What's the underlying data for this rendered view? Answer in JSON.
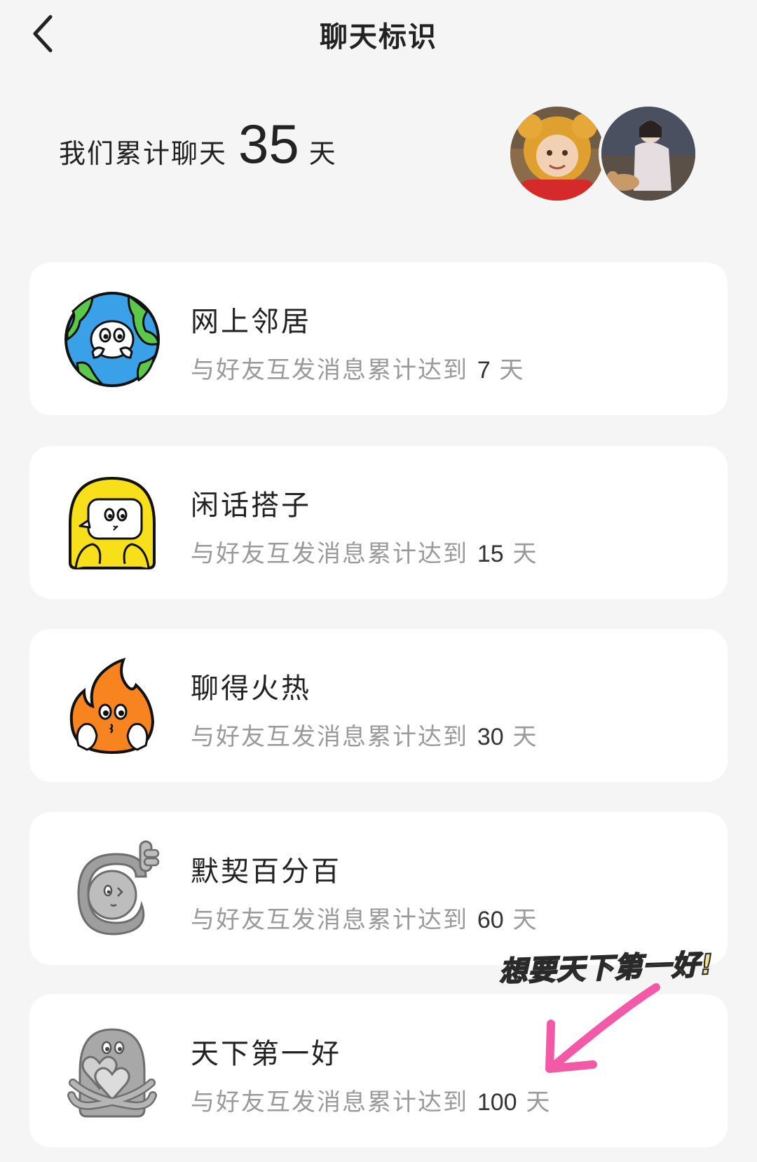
{
  "header": {
    "title": "聊天标识"
  },
  "summary": {
    "prefix": "我们累计聊天",
    "days": "35",
    "unit": "天"
  },
  "badges": [
    {
      "title": "网上邻居",
      "desc_prefix": "与好友互发消息累计达到",
      "days": "7",
      "unit": "天",
      "icon": "globe-character-icon",
      "unlocked": true
    },
    {
      "title": "闲话搭子",
      "desc_prefix": "与好友互发消息累计达到",
      "days": "15",
      "unit": "天",
      "icon": "chat-bubble-character-icon",
      "unlocked": true
    },
    {
      "title": "聊得火热",
      "desc_prefix": "与好友互发消息累计达到",
      "days": "30",
      "unit": "天",
      "icon": "flame-character-icon",
      "unlocked": true
    },
    {
      "title": "默契百分百",
      "desc_prefix": "与好友互发消息累计达到",
      "days": "60",
      "unit": "天",
      "icon": "hug-character-icon",
      "unlocked": false
    },
    {
      "title": "天下第一好",
      "desc_prefix": "与好友互发消息累计达到",
      "days": "100",
      "unit": "天",
      "icon": "heart-character-icon",
      "unlocked": false
    }
  ],
  "annotation": {
    "text": "想要天下第一好!"
  },
  "colors": {
    "background": "#f5f5f5",
    "card": "#ffffff",
    "desc_text": "#9a9a9a",
    "locked_badge": "#9e9e9e",
    "annotation_arrow": "#f25aa8",
    "annotation_text": "#f4e18a"
  }
}
